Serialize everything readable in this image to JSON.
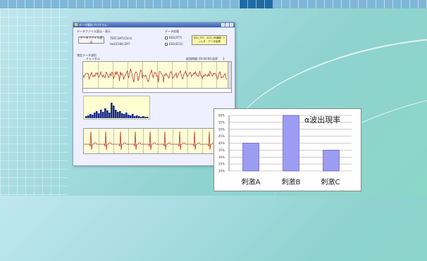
{
  "app": {
    "title": "データ解析プログラム",
    "group1": "データファイル読込・表示",
    "load_button": "データファイル読込",
    "file_name": "TEST.DAT(15ch)",
    "file_info": "test(CH8).DAT",
    "group2": "データ処理",
    "check1": "EEG(FFT)",
    "check2": "EEG(ECG)",
    "exec_button": "EEG_FFT、ECG_HR解析 フィルタ・データ処理",
    "wave_label": "測定データ波形",
    "ch_label": "チャンネル",
    "time_label": "経過時間",
    "time_value": "00:00:00",
    "zoom_label": "倍率",
    "zoom_value": "1"
  },
  "chart_data": {
    "type": "bar",
    "title": "α波出現率",
    "categories": [
      "刺激A",
      "刺激B",
      "刺激C"
    ],
    "values": [
      40,
      60,
      35
    ],
    "yticks": [
      "20%",
      "25%",
      "30%",
      "35%",
      "40%",
      "45%",
      "50%",
      "55%",
      "60%"
    ],
    "ylim": [
      20,
      60
    ],
    "bar_color": "#9c9cf2",
    "grid": true
  }
}
